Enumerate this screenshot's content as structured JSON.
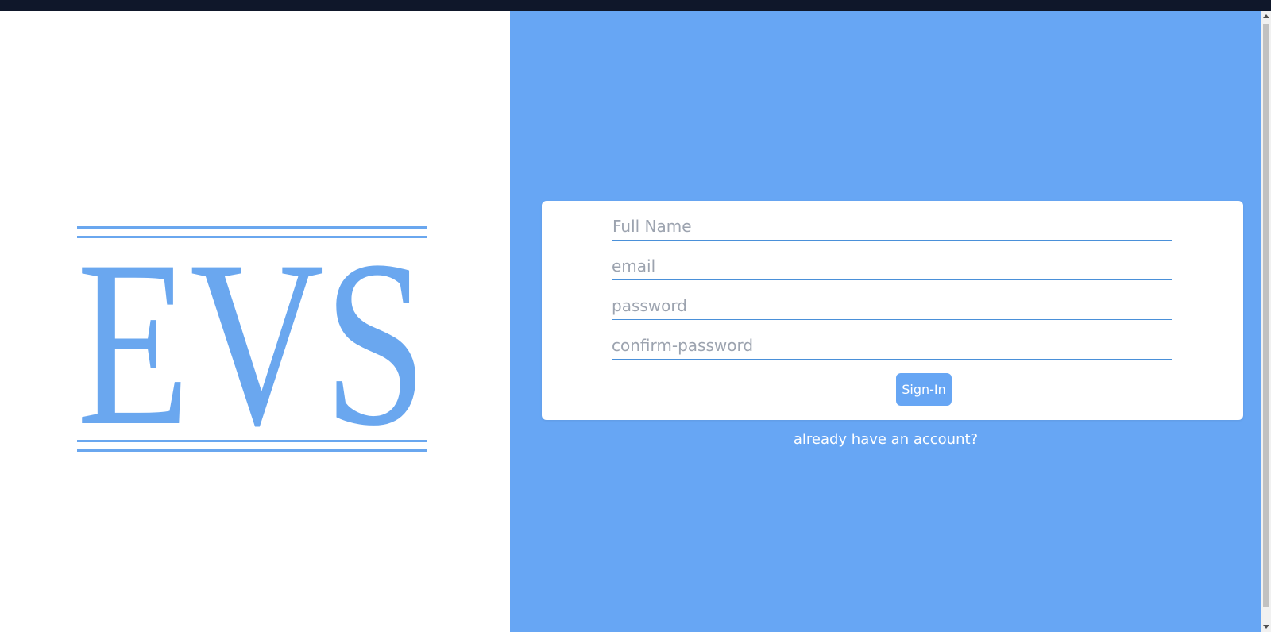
{
  "logo": {
    "text": "EVS",
    "color": "#6aa7ef"
  },
  "form": {
    "full_name_placeholder": "Full Name",
    "email_placeholder": "email",
    "password_placeholder": "password",
    "confirm_password_placeholder": "confirm-password",
    "submit_label": "Sign-In"
  },
  "account_link": {
    "label": "already have an account?"
  },
  "colors": {
    "accent": "#67a6f4",
    "topbar": "#0f172a",
    "input_underline": "#4a90d9"
  }
}
